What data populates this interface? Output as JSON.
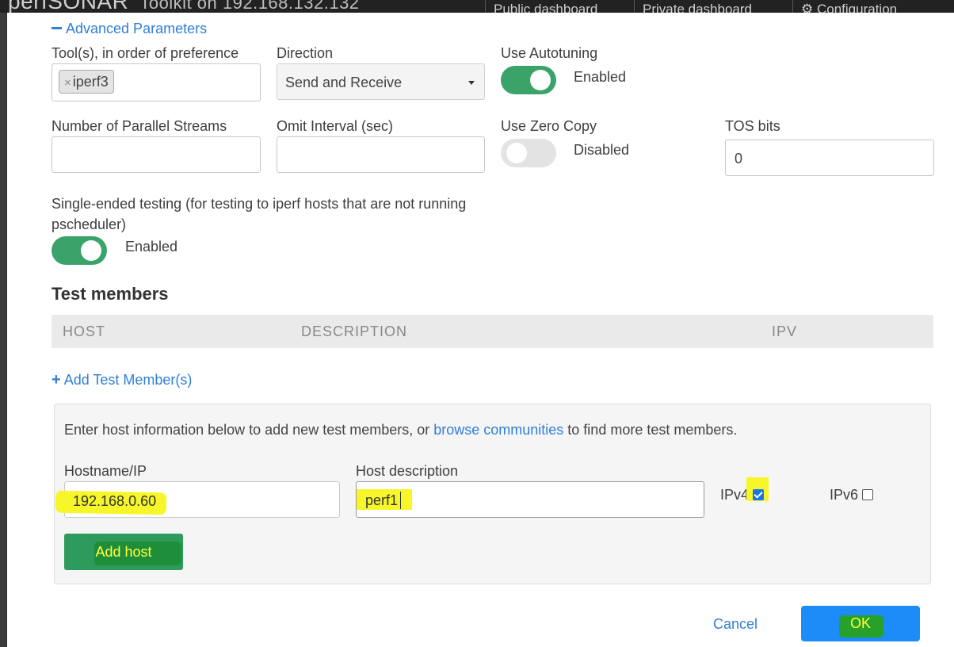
{
  "background": {
    "brand": "perfSONAR",
    "subtitle": "Toolkit on 192.168.132.132",
    "tabs": [
      "Public dashboard",
      "Private dashboard",
      "Configuration"
    ]
  },
  "advanced": {
    "toggle_label": "Advanced Parameters",
    "tools_label": "Tool(s), in order of preference",
    "tool_tag": "iperf3",
    "tag_remove": "×",
    "direction_label": "Direction",
    "direction_value": "Send and Receive",
    "autotuning_label": "Use Autotuning",
    "autotuning_status": "Enabled",
    "streams_label": "Number of Parallel Streams",
    "streams_value": "",
    "omit_label": "Omit Interval (sec)",
    "omit_value": "",
    "zerocopy_label": "Use Zero Copy",
    "zerocopy_status": "Disabled",
    "tos_label": "TOS bits",
    "tos_value": "0",
    "single_ended_label": "Single-ended testing (for testing to iperf hosts that are not running pscheduler)",
    "single_ended_status": "Enabled"
  },
  "members": {
    "title": "Test members",
    "columns": [
      "HOST",
      "DESCRIPTION",
      "IPV"
    ],
    "add_link": "Add Test Member(s)",
    "add_icon": "plus-icon"
  },
  "add_panel": {
    "info_before": "Enter host information below to add new test members, or ",
    "info_link": "browse communities",
    "info_after": " to find more test members.",
    "hostname_label": "Hostname/IP",
    "hostname_value": "192.168.0.60",
    "description_label": "Host description",
    "description_value": "perf1",
    "ipv4_label": "IPv4",
    "ipv4_checked": true,
    "ipv6_label": "IPv6",
    "ipv6_checked": false,
    "add_button": "Add host"
  },
  "footer": {
    "cancel": "Cancel",
    "ok": "OK"
  },
  "colors": {
    "link": "#2f7fd6",
    "toggle_on": "#3aa36a",
    "ok_button": "#1d8cf8",
    "add_button": "#2e9a5b",
    "highlight": "#f6f62a"
  }
}
